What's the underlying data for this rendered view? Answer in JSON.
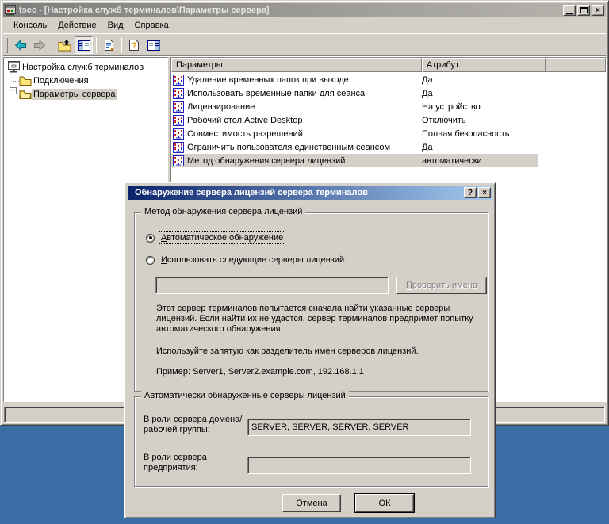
{
  "colors": {
    "desktop": "#3A6EA5",
    "window_face": "#D4D0C8",
    "active_title_start": "#0A246A",
    "active_title_end": "#A6CAF0",
    "inactive_title_start": "#7E7E7E",
    "inactive_title_end": "#B8B5AE",
    "inactive_selection": "#D4D0C8",
    "list_bg": "#FFFFFF"
  },
  "icons": {
    "help_glyph": "?",
    "close_glyph": "×",
    "expander_glyph": "+"
  },
  "main_window": {
    "title": "tscc - [Настройка служб терминалов\\Параметры сервера]",
    "menu": {
      "items": [
        {
          "label": "Консоль"
        },
        {
          "label": "Действие"
        },
        {
          "label": "Вид"
        },
        {
          "label": "Справка"
        }
      ]
    },
    "tree": {
      "root": {
        "label": "Настройка служб терминалов"
      },
      "items": [
        {
          "label": "Подключения",
          "selected": false
        },
        {
          "label": "Параметры сервера",
          "selected": true,
          "expander": "+"
        }
      ]
    },
    "list": {
      "columns": [
        {
          "label": "Параметры"
        },
        {
          "label": "Атрибут"
        }
      ],
      "rows": [
        {
          "name": "Удаление временных папок при выходе",
          "value": "Да"
        },
        {
          "name": "Использовать временные папки для сеанса",
          "value": "Да"
        },
        {
          "name": "Лицензирование",
          "value": "На устройство"
        },
        {
          "name": "Рабочий стол Active Desktop",
          "value": "Отключить"
        },
        {
          "name": "Совместимость разрешений",
          "value": "Полная безопасность"
        },
        {
          "name": "Ограничить пользователя единственным сеансом",
          "value": "Да"
        },
        {
          "name": "Метод обнаружения сервера лицензий",
          "value": "автоматически",
          "selected": true
        }
      ]
    }
  },
  "dialog": {
    "title": "Обнаружение сервера лицензий сервера терминалов",
    "discovery_group": {
      "legend": "Метод обнаружения сервера лицензий",
      "radio_auto_label": "Автоматическое обнаружение",
      "radio_auto_selected": true,
      "radio_specified_label": "Использовать следующие серверы лицензий:",
      "radio_specified_selected": false,
      "server_input_value": "",
      "check_names_button": "Проверить имена",
      "description": "Этот сервер терминалов попытается сначала найти указанные серверы лицензий. Если найти их не удастся, сервер терминалов предпримет попытку автоматического обнаружения.",
      "separator_hint": "Используйте запятую как разделитель имен серверов лицензий.",
      "example": "Пример: Server1, Server2.example.com, 192.168.1.1"
    },
    "discovered_group": {
      "legend": "Автоматически обнаруженные серверы лицензий",
      "domain_label": "В роли сервера домена/рабочей группы:",
      "domain_value": "SERVER, SERVER, SERVER, SERVER",
      "enterprise_label": "В роли сервера предприятия:",
      "enterprise_value": ""
    },
    "buttons": {
      "cancel": "Отмена",
      "ok": "ОК"
    }
  }
}
